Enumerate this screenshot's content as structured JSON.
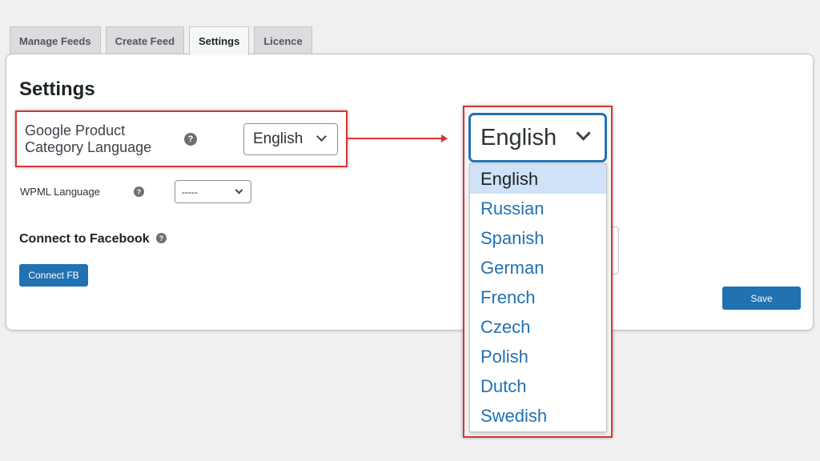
{
  "tabs": [
    {
      "label": "Manage Feeds"
    },
    {
      "label": "Create Feed"
    },
    {
      "label": "Settings"
    },
    {
      "label": "Licence"
    }
  ],
  "page_title": "Settings",
  "google_category": {
    "label": "Google Product Category Language",
    "help": "?",
    "value": "English"
  },
  "wpml": {
    "label": "WPML Language",
    "help": "?",
    "value": "-----"
  },
  "facebook": {
    "title": "Connect to Facebook",
    "help": "?",
    "button": "Connect FB"
  },
  "save_button": "Save",
  "zoom": {
    "selected": "English",
    "options": [
      "English",
      "Russian",
      "Spanish",
      "German",
      "French",
      "Czech",
      "Polish",
      "Dutch",
      "Swedish"
    ]
  },
  "colors": {
    "accent": "#2271b1",
    "highlight": "#d63638",
    "selected_bg": "#cfe2f7"
  }
}
